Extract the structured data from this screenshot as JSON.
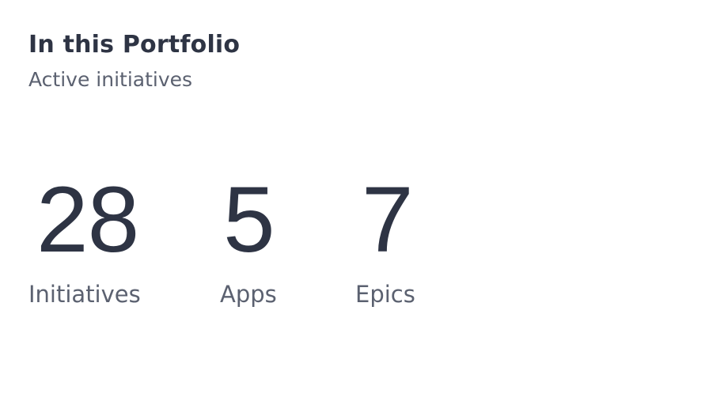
{
  "header": {
    "title": "In this Portfolio",
    "subtitle": "Active initiatives"
  },
  "stats": [
    {
      "value": "28",
      "label": "Initiatives"
    },
    {
      "value": "5",
      "label": "Apps"
    },
    {
      "value": "7",
      "label": "Epics"
    }
  ],
  "colors": {
    "heading": "#2e3444",
    "muted": "#5b6170",
    "background": "#ffffff"
  }
}
